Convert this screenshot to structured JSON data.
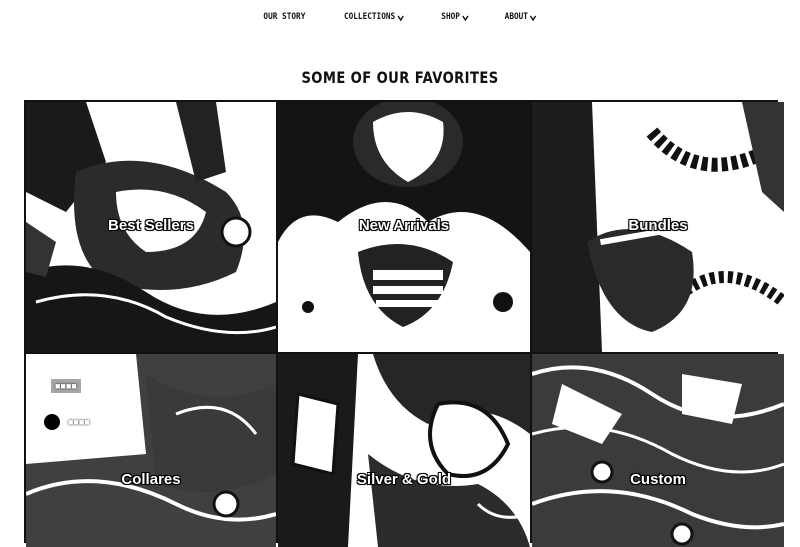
{
  "nav": {
    "items": [
      {
        "label": "OUR STORY",
        "dropdown": false
      },
      {
        "label": "COLLECTIONS",
        "dropdown": true
      },
      {
        "label": "SHOP",
        "dropdown": true
      },
      {
        "label": "ABOUT",
        "dropdown": true
      }
    ]
  },
  "section": {
    "title": "SOME OF OUR FAVORITES"
  },
  "tiles": [
    {
      "label": "Best Sellers"
    },
    {
      "label": "New Arrivals"
    },
    {
      "label": "Bundles"
    },
    {
      "label": "Collares"
    },
    {
      "label": "Silver & Gold"
    },
    {
      "label": "Custom"
    }
  ],
  "colors": {
    "text": "#111111",
    "tile_label": "#ffffff",
    "background": "#ffffff"
  }
}
